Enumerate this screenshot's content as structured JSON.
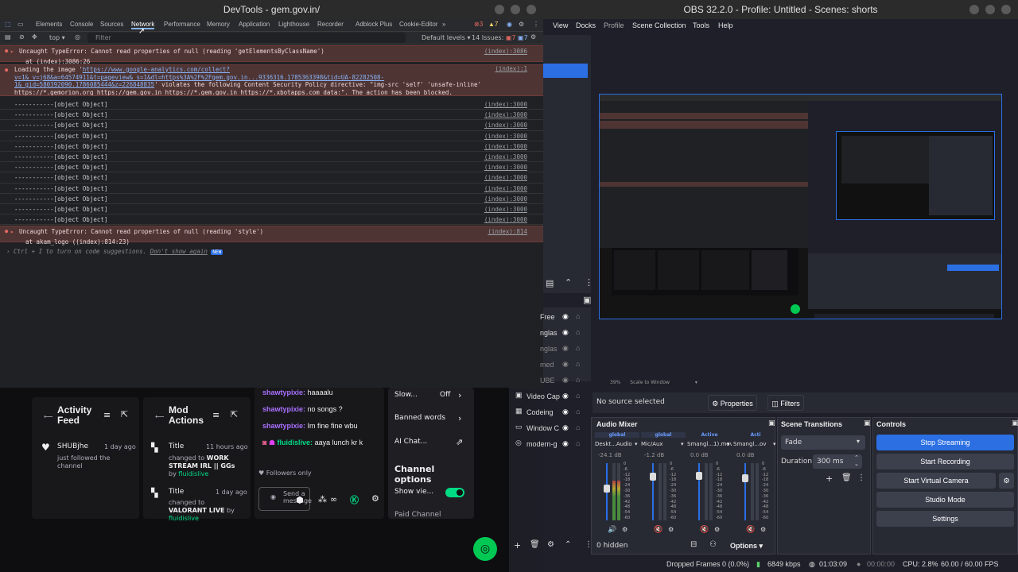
{
  "devtools": {
    "title": "DevTools - gem.gov.in/",
    "tabs": [
      "Elements",
      "Console",
      "Sources",
      "Network",
      "Performance",
      "Memory",
      "Application",
      "Lighthouse",
      "Recorder",
      "Adblock Plus",
      "Cookie-Editor"
    ],
    "error_count": "3",
    "warn_count": "7",
    "context": "top",
    "filter_placeholder": "Filter",
    "levels": "Default levels",
    "issues": "14 Issues:",
    "issues_errors": "7",
    "issues_info": "7",
    "console": {
      "error1": "Uncaught TypeError: Cannot read properties of null (reading 'getElementsByClassName')",
      "error1_at": "at (index):3086:26",
      "error1_src": "(index):3086",
      "csp_line1": "Loading the image '",
      "csp_url": "https://www.google-analytics.com/collect?v=1&_v=j68&a=64574911&t=pageview&_s=1&dl=https%3A%2F%2Fgem.gov.in...9336316.1785363398&tid=UA-82282508-1&_gid=580392090.1786085444&z=226848835",
      "csp_line2": "' violates the following Content Security Policy directive: \"img-src 'self' 'unsafe-inline' https://*.gemorion.org https://gem.gov.in https://*.gem.gov.in https://*.xbotapps.com data:\". The action has been blocked.",
      "csp_src": "(index):1",
      "log_text": "-----------[object Object]",
      "log_src": "(index):3000",
      "error2": "Uncaught TypeError: Cannot read properties of null (reading 'style')",
      "error2_at": "at akam_logo ((index):814:23)",
      "error2_src": "(index):814",
      "hint": "Ctrl + I to turn on code suggestions.",
      "dont_show": "Don't show again",
      "new_badge": "NEW"
    }
  },
  "twitch": {
    "activity_feed": "Activity Feed",
    "mod_actions": "Mod Actions",
    "feed_user": "SHUBjhe",
    "feed_time": "1 day ago",
    "feed_text": "just followed the channel",
    "mod1_title": "Title",
    "mod1_time": "11 hours ago",
    "mod1_text1": "changed to",
    "mod1_text2": "WORK STREAM IRL || GGs",
    "mod1_by": "by",
    "mod1_user": "fluidislive",
    "mod2_title": "Title",
    "mod2_time": "1 day ago",
    "mod2_text1": "changed to",
    "mod2_text2": "VALORANT LIVE",
    "mod2_by": "by",
    "mod2_user": "fluidislive",
    "chat": [
      {
        "user": "shawtypixie:",
        "msg": "haaaalu"
      },
      {
        "user": "shawtypixie:",
        "msg": "no songs ?"
      },
      {
        "user": "shawtypixie:",
        "msg": "Im fine fine wbu"
      },
      {
        "user": "fluidislive:",
        "msg": "aaya lunch kr k"
      }
    ],
    "followers_only": "Followers only",
    "send_placeholder": "Send a message",
    "menu": {
      "slow": "Slow...",
      "slow_value": "Off",
      "banned": "Banned words",
      "ai_chat": "AI Chat...",
      "channel_options": "Channel options",
      "show_viewers": "Show vie...",
      "paid": "Paid Channel"
    }
  },
  "obs": {
    "title": "OBS 32.2.0 - Profile: Untitled - Scenes: shorts",
    "menu": [
      "View",
      "Docks",
      "Profile",
      "Scene Collection",
      "Tools",
      "Help"
    ],
    "sources": [
      "Free",
      "nglas",
      "nglas",
      "med",
      "UBE",
      "Video Cap",
      "Codeing",
      "Window C",
      "modern-g"
    ],
    "zoom": "39%",
    "scale": "Scale to Window",
    "no_source": "No source selected",
    "properties": "Properties",
    "filters": "Filters",
    "audio_mixer": "Audio Mixer",
    "channels": [
      {
        "name": "Deskt...Audio",
        "db": "-24.1 dB",
        "tag": "global"
      },
      {
        "name": "Mic/Aux",
        "db": "-1.2 dB",
        "tag": "global"
      },
      {
        "name": "Smangl...1).mov",
        "db": "0.0 dB",
        "tag": "Active"
      },
      {
        "name": "Smangl...ov",
        "db": "0.0 dB",
        "tag": "Acti"
      }
    ],
    "scale_marks": [
      "0",
      "-6",
      "-12",
      "-18",
      "-24",
      "-30",
      "-36",
      "-42",
      "-48",
      "-54",
      "-60"
    ],
    "hidden": "0 hidden",
    "options": "Options",
    "transitions": "Scene Transitions",
    "transition": "Fade",
    "duration_label": "Duration",
    "duration": "300 ms",
    "controls": "Controls",
    "stop_streaming": "Stop Streaming",
    "start_recording": "Start Recording",
    "start_virtual": "Start Virtual Camera",
    "studio_mode": "Studio Mode",
    "settings": "Settings",
    "status": {
      "dropped": "Dropped Frames 0 (0.0%)",
      "kbps": "6849 kbps",
      "time1": "01:03:09",
      "time2": "00:00:00",
      "cpu": "CPU: 2.8%",
      "fps": "60.00 / 60.00 FPS"
    },
    "colors": {
      "accent": "#2b6fe3",
      "live": "#5bd36b"
    }
  }
}
